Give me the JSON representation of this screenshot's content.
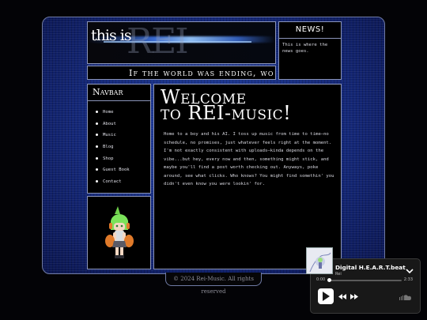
{
  "header": {
    "logo_small": "this is",
    "logo_big": "REI",
    "marquee": "If the world was ending, wo"
  },
  "news": {
    "title": "NEWS!",
    "body": "This is where the news goes."
  },
  "navbar": {
    "title": "Navbar",
    "items": [
      {
        "label": "Home"
      },
      {
        "label": "About"
      },
      {
        "label": "Music"
      },
      {
        "label": "Blog"
      },
      {
        "label": "Shop"
      },
      {
        "label": "Guest Book"
      },
      {
        "label": "Contact"
      }
    ]
  },
  "main": {
    "heading_line1": "Welcome",
    "heading_line2": "to REI-music!",
    "body": "Home to a boy and his AI. I toss up music from time to time—no schedule, no promises, just whatever feels right at the moment. I'm not exactly consistent with uploads—kinda depends on the vibe...but hey, every now and then, something might stick, and maybe you'll find a post worth checking out. Anyways, poke around, see what clicks. Who knows? You might find somethin' you didn't even know you were lookin' for."
  },
  "footer": {
    "text": "© 2024 Rei-Music. All rights reserved"
  },
  "player": {
    "track_title": "Digital H.E.A.R.T.beat",
    "artist": "Rei",
    "time_current": "0:00",
    "time_total": "2:33",
    "progress": 0.0,
    "icons": [
      "chevron-down-icon",
      "play-icon",
      "rewind-icon",
      "fast-forward-icon",
      "soundcloud-icon"
    ]
  },
  "colors": {
    "frame_blue": "#14287a",
    "border": "#8a94b8",
    "player_bg": "#181818"
  }
}
